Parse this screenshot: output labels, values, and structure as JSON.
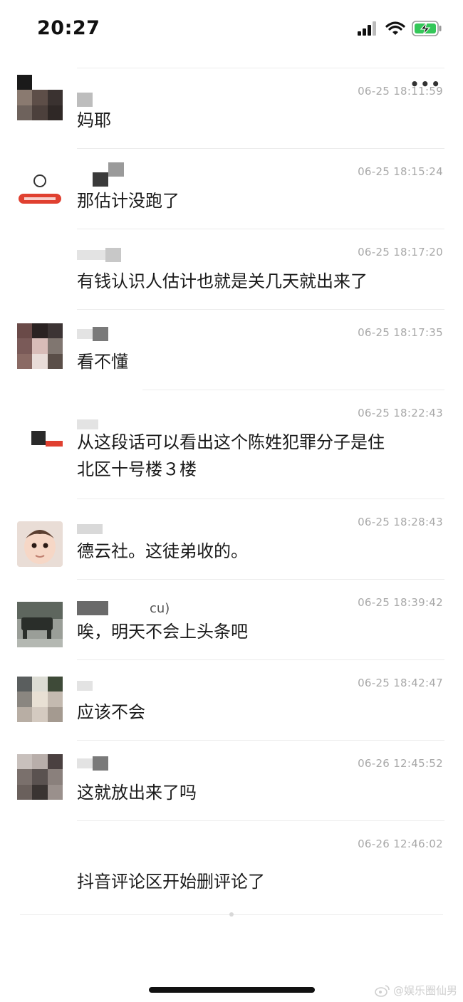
{
  "status_bar": {
    "time": "20:27",
    "icons": [
      "signal-icon",
      "wifi-icon",
      "battery-charging-icon"
    ],
    "battery_color": "#34c759"
  },
  "more_menu_icon": "ellipsis-icon",
  "messages": [
    {
      "time": "06-25 18:11:59",
      "text": "妈耶"
    },
    {
      "time": "06-25 18:15:24",
      "text": "那估计没跑了"
    },
    {
      "time": "06-25 18:17:20",
      "text": "有钱认识人估计也就是关几天就出来了"
    },
    {
      "time": "06-25 18:17:35",
      "text": "看不懂"
    },
    {
      "time": "06-25 18:22:43",
      "text": "从这段话可以看出这个陈姓犯罪分子是住\n北区十号楼３楼"
    },
    {
      "time": "06-25 18:28:43",
      "text": "德云社。这徒弟收的。"
    },
    {
      "time": "06-25 18:39:42",
      "nick_suffix": "cu)",
      "text": "唉，明天不会上头条吧"
    },
    {
      "time": "06-25 18:42:47",
      "text": "应该不会"
    },
    {
      "time": "06-26 12:45:52",
      "text": "这就放出来了吗"
    },
    {
      "time": "06-26 12:46:02",
      "text": "抖音评论区开始删评论了"
    }
  ],
  "watermark": {
    "icon": "weibo-icon",
    "text": "@娱乐圈仙男"
  }
}
